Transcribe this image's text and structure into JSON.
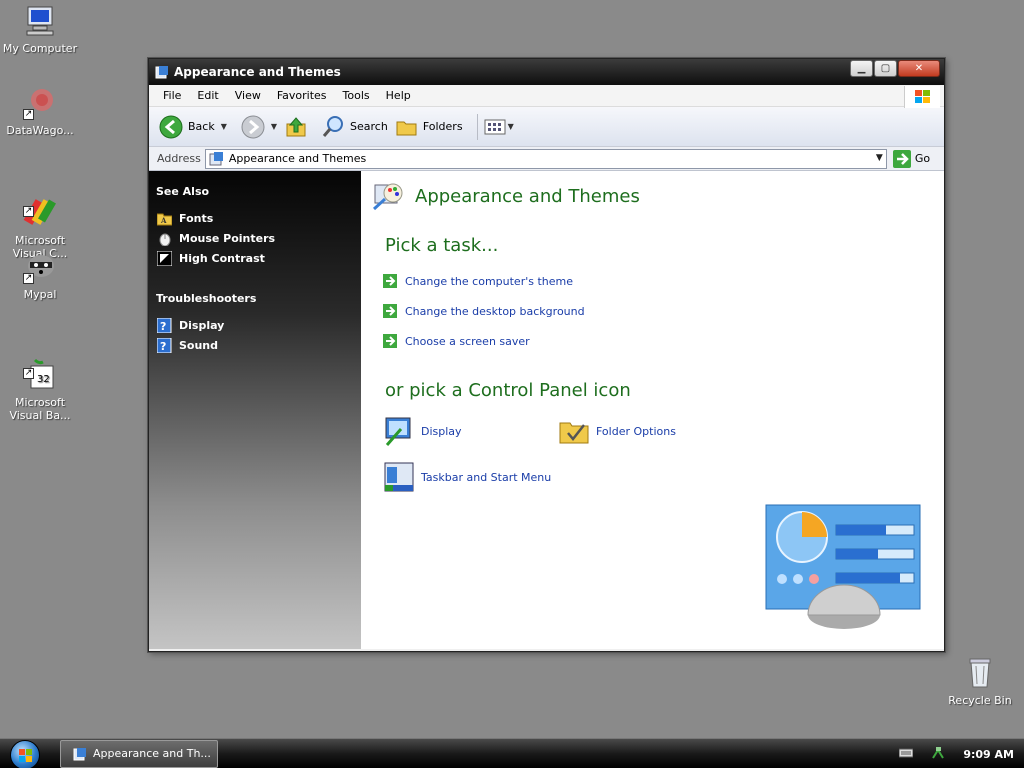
{
  "desktop": {
    "icons": [
      {
        "label": "My Computer"
      },
      {
        "label": "DataWago..."
      },
      {
        "label": "Microsoft\nVisual C..."
      },
      {
        "label": "Mypal"
      },
      {
        "label": "Microsoft\nVisual Ba..."
      }
    ],
    "recycle_bin": "Recycle Bin"
  },
  "window": {
    "title": "Appearance and Themes",
    "menu": [
      "File",
      "Edit",
      "View",
      "Favorites",
      "Tools",
      "Help"
    ],
    "toolbar": {
      "back": "Back",
      "search": "Search",
      "folders": "Folders"
    },
    "address": {
      "label": "Address",
      "value": "Appearance and Themes",
      "go": "Go"
    }
  },
  "left_pane": {
    "see_also": {
      "heading": "See Also",
      "items": [
        "Fonts",
        "Mouse Pointers",
        "High Contrast"
      ]
    },
    "troubleshooters": {
      "heading": "Troubleshooters",
      "items": [
        "Display",
        "Sound"
      ]
    }
  },
  "main": {
    "title": "Appearance and Themes",
    "pick_task": "Pick a task...",
    "tasks": [
      "Change the computer's theme",
      "Change the desktop background",
      "Choose a screen saver"
    ],
    "pick_icon": "or pick a Control Panel icon",
    "icons": [
      "Display",
      "Folder Options",
      "Taskbar and Start Menu"
    ]
  },
  "taskbar": {
    "task_button": "Appearance and Th...",
    "clock": "9:09 AM"
  },
  "colors": {
    "heading_green": "#1e6e1e",
    "link_blue": "#1a3da8"
  }
}
